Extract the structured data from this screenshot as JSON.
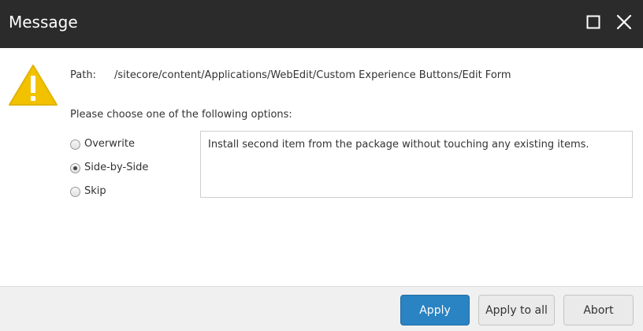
{
  "window": {
    "title": "Message",
    "maximize_icon": "maximize-icon",
    "close_icon": "close-icon"
  },
  "icon": {
    "name": "warning-icon",
    "color": "#f2c200"
  },
  "path": {
    "label": "Path:",
    "value": "/sitecore/content/Applications/WebEdit/Custom Experience Buttons/Edit Form"
  },
  "prompt": "Please choose one of the following options:",
  "options": [
    {
      "label": "Overwrite",
      "selected": false
    },
    {
      "label": "Side-by-Side",
      "selected": true
    },
    {
      "label": "Skip",
      "selected": false
    }
  ],
  "description": "Install second item from the package without touching any existing items.",
  "buttons": {
    "apply": "Apply",
    "apply_all": "Apply to all",
    "abort": "Abort"
  },
  "colors": {
    "titlebar": "#2b2b2b",
    "primary": "#2a83c2",
    "footer": "#f0f0f0"
  }
}
